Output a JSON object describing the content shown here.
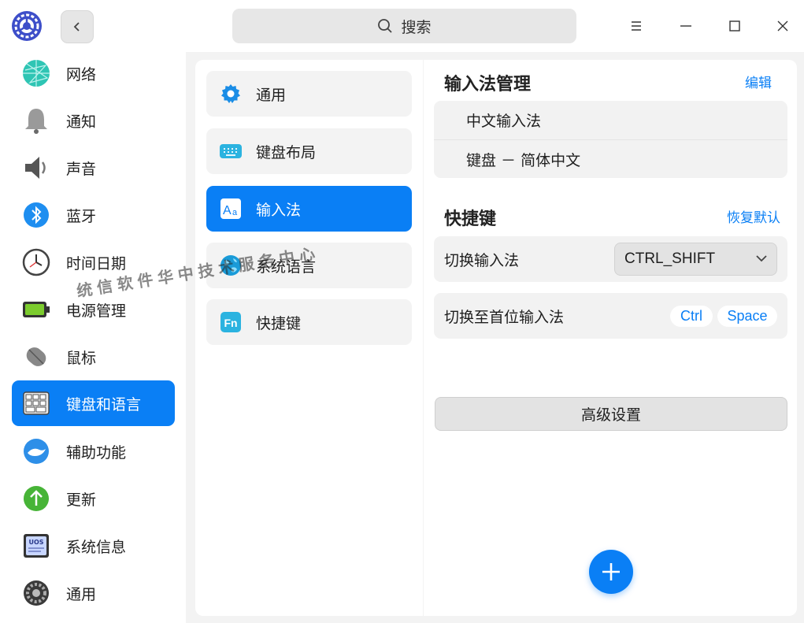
{
  "titlebar": {
    "search_label": "搜索",
    "icons": {
      "app": "settings-app-icon",
      "back": "chevron-left-icon",
      "search": "search-icon",
      "menu": "menu-icon",
      "minimize": "minimize-icon",
      "maximize": "maximize-icon",
      "close": "close-icon"
    }
  },
  "sidebar": {
    "items": [
      {
        "label": "网络",
        "icon": "network-icon"
      },
      {
        "label": "通知",
        "icon": "bell-icon"
      },
      {
        "label": "声音",
        "icon": "speaker-icon"
      },
      {
        "label": "蓝牙",
        "icon": "bluetooth-icon"
      },
      {
        "label": "时间日期",
        "icon": "clock-icon"
      },
      {
        "label": "电源管理",
        "icon": "battery-icon"
      },
      {
        "label": "鼠标",
        "icon": "mouse-icon"
      },
      {
        "label": "键盘和语言",
        "icon": "keyboard-icon",
        "active": true
      },
      {
        "label": "辅助功能",
        "icon": "accessibility-icon"
      },
      {
        "label": "更新",
        "icon": "update-icon"
      },
      {
        "label": "系统信息",
        "icon": "system-info-icon"
      },
      {
        "label": "通用",
        "icon": "general-icon"
      }
    ]
  },
  "submenu": {
    "items": [
      {
        "label": "通用",
        "icon": "gear-icon"
      },
      {
        "label": "键盘布局",
        "icon": "keyboard-layout-icon"
      },
      {
        "label": "输入法",
        "icon": "input-method-icon",
        "active": true
      },
      {
        "label": "系统语言",
        "icon": "globe-icon"
      },
      {
        "label": "快捷键",
        "icon": "fn-key-icon"
      }
    ]
  },
  "content": {
    "im_section": {
      "title": "输入法管理",
      "edit_label": "编辑",
      "methods": [
        "中文输入法",
        "键盘 － 简体中文"
      ]
    },
    "shortcut_section": {
      "title": "快捷键",
      "reset_label": "恢复默认",
      "switch_im_label": "切换输入法",
      "switch_im_value": "CTRL_SHIFT",
      "switch_first_label": "切换至首位输入法",
      "switch_first_keys": [
        "Ctrl",
        "Space"
      ]
    },
    "advanced_label": "高级设置",
    "add_icon": "plus-icon"
  },
  "watermark": "统信软件华中技术服务中心",
  "colors": {
    "accent": "#0a7ff5",
    "background": "#f3f3f3",
    "panel": "#ffffff"
  }
}
